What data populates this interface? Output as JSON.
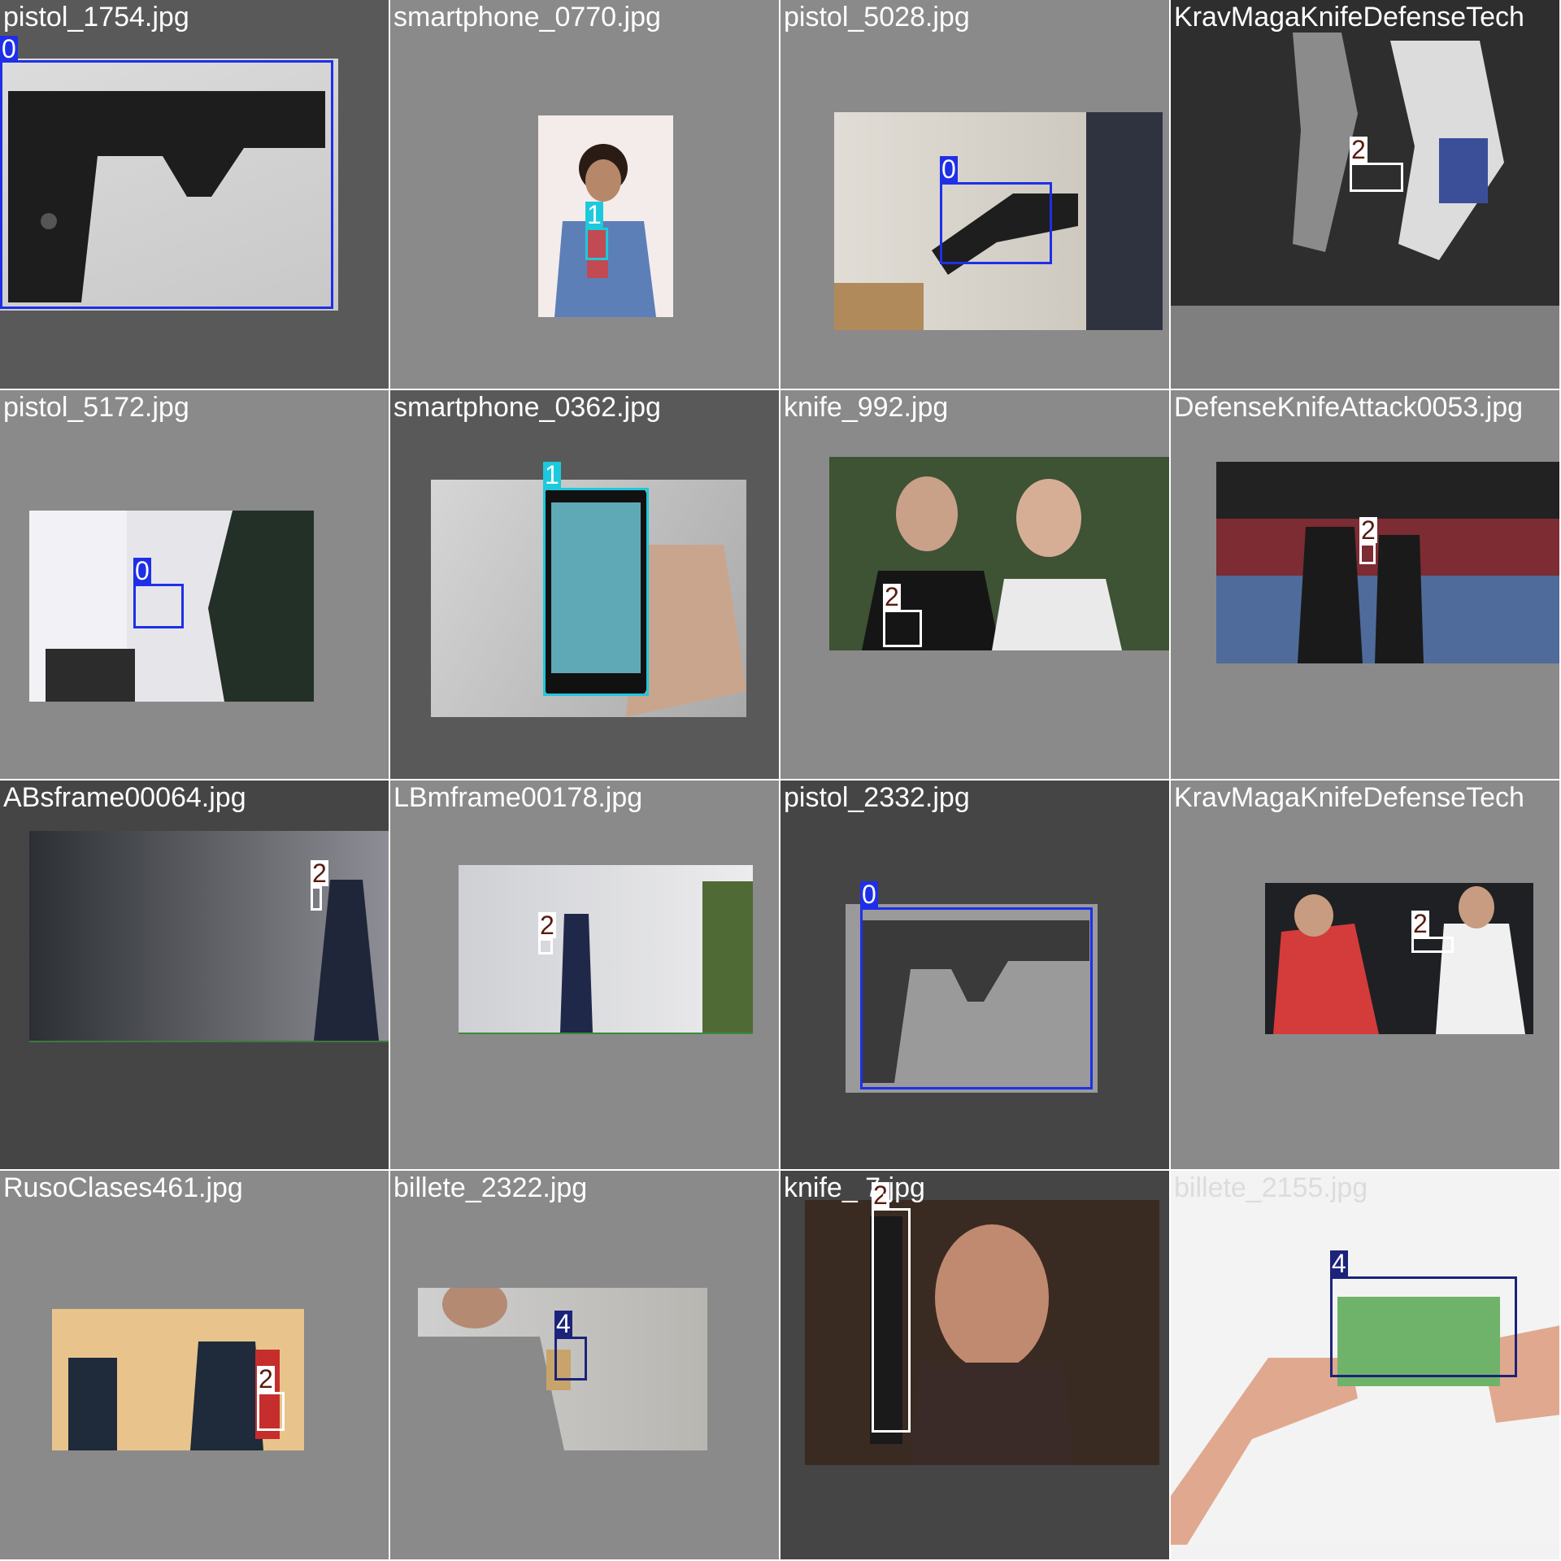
{
  "tiles": [
    {
      "filename": "pistol_1754.jpg",
      "labels": [
        "0"
      ]
    },
    {
      "filename": "smartphone_0770.jpg",
      "labels": [
        "1"
      ]
    },
    {
      "filename": "pistol_5028.jpg",
      "labels": [
        "0"
      ]
    },
    {
      "filename": "KravMagaKnifeDefenseTech",
      "labels": [
        "2"
      ]
    },
    {
      "filename": "pistol_5172.jpg",
      "labels": [
        "0"
      ]
    },
    {
      "filename": "smartphone_0362.jpg",
      "labels": [
        "1"
      ]
    },
    {
      "filename": "knife_992.jpg",
      "labels": [
        "2"
      ]
    },
    {
      "filename": "DefenseKnifeAttack0053.jpg",
      "labels": [
        "2"
      ]
    },
    {
      "filename": "ABsframe00064.jpg",
      "labels": [
        "2"
      ]
    },
    {
      "filename": "LBmframe00178.jpg",
      "labels": [
        "2"
      ]
    },
    {
      "filename": "pistol_2332.jpg",
      "labels": [
        "0"
      ]
    },
    {
      "filename": "KravMagaKnifeDefenseTech",
      "labels": [
        "2"
      ]
    },
    {
      "filename": "RusoClases461.jpg",
      "labels": [
        "2"
      ]
    },
    {
      "filename": "billete_2322.jpg",
      "labels": [
        "4"
      ]
    },
    {
      "filename": "knife_  7.jpg",
      "labels": [
        "2"
      ]
    },
    {
      "filename": "billete_2155.jpg",
      "labels": [
        "4"
      ]
    }
  ],
  "class_colors": {
    "0": "#1f2fe8",
    "1": "#1dc9dc",
    "2": "#ffffff",
    "4": "#1b237a"
  }
}
